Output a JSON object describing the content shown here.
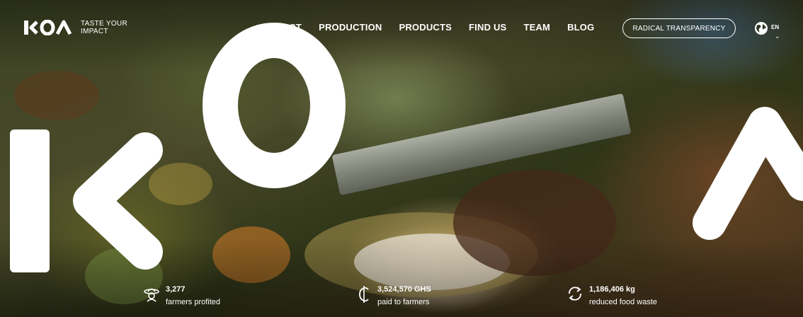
{
  "brand": {
    "logo_text": "KOA",
    "tagline": "TASTE YOUR IMPACT"
  },
  "nav": {
    "items": [
      {
        "label": "IMPACT"
      },
      {
        "label": "PRODUCTION"
      },
      {
        "label": "PRODUCTS"
      },
      {
        "label": "FIND US"
      },
      {
        "label": "TEAM"
      },
      {
        "label": "BLOG"
      }
    ],
    "cta_label": "RADICAL TRANSPARENCY"
  },
  "language": {
    "icon": "globe-icon",
    "label": "EN",
    "dropdown_icon": "chevron-down-icon"
  },
  "stats": [
    {
      "icon": "farmer-hat-icon",
      "value": "3,277",
      "label": "farmers profited"
    },
    {
      "icon": "cedi-currency-icon",
      "value": "3,524,570 GHS",
      "label": "paid to farmers"
    },
    {
      "icon": "recycle-arrows-icon",
      "value": "1,186,406 kg",
      "label": "reduced food waste"
    }
  ],
  "colors": {
    "text": "#ffffff",
    "overlay_letters": "#ffffff"
  }
}
